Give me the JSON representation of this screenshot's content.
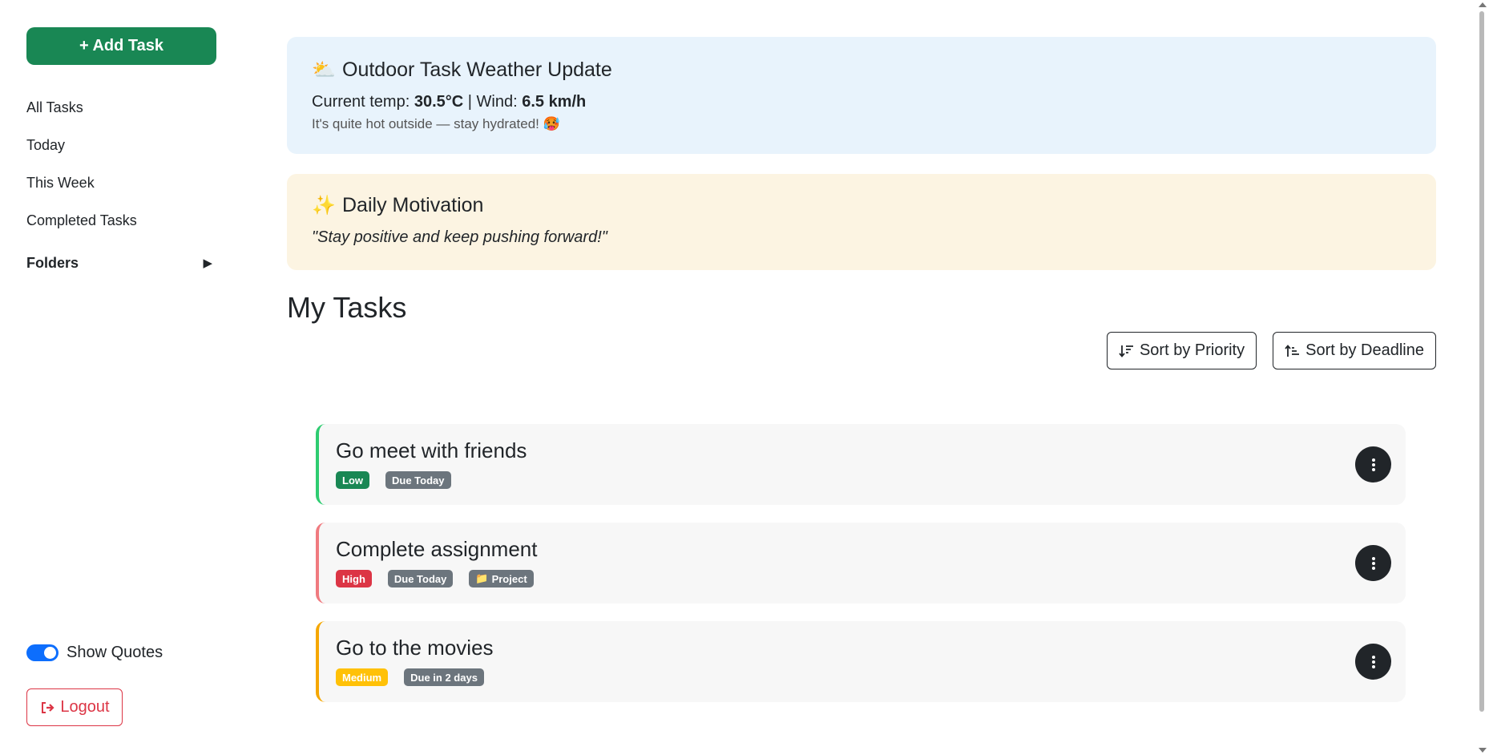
{
  "sidebar": {
    "add_task_label": "+ Add Task",
    "nav": [
      "All Tasks",
      "Today",
      "This Week",
      "Completed Tasks"
    ],
    "folders_label": "Folders",
    "folders_caret": "▶",
    "show_quotes_label": "Show Quotes",
    "show_quotes_on": true,
    "logout_label": "Logout"
  },
  "weather": {
    "icon": "⛅",
    "title": "Outdoor Task Weather Update",
    "temp_label": "Current temp: ",
    "temp_value": "30.5°C",
    "separator": " | Wind: ",
    "wind_value": "6.5 km/h",
    "note": "It's quite hot outside — stay hydrated! 🥵"
  },
  "motivation": {
    "icon": "✨",
    "title": "Daily Motivation",
    "quote": "\"Stay positive and keep pushing forward!\""
  },
  "main": {
    "title": "My Tasks",
    "sort_priority_label": "Sort by Priority",
    "sort_deadline_label": "Sort by Deadline"
  },
  "tasks": [
    {
      "title": "Go meet with friends",
      "priority": "Low",
      "priority_color": "#198754",
      "border_color": "#2ecc71",
      "due": "Due Today"
    },
    {
      "title": "Complete assignment",
      "priority": "High",
      "priority_color": "#dc3545",
      "border_color": "#f07a7f",
      "due": "Due Today",
      "folder": "Project",
      "folder_icon": "📁"
    },
    {
      "title": "Go to the movies",
      "priority": "Medium",
      "priority_color": "#ffc107",
      "border_color": "#f5a700",
      "due": "Due in 2 days"
    }
  ]
}
